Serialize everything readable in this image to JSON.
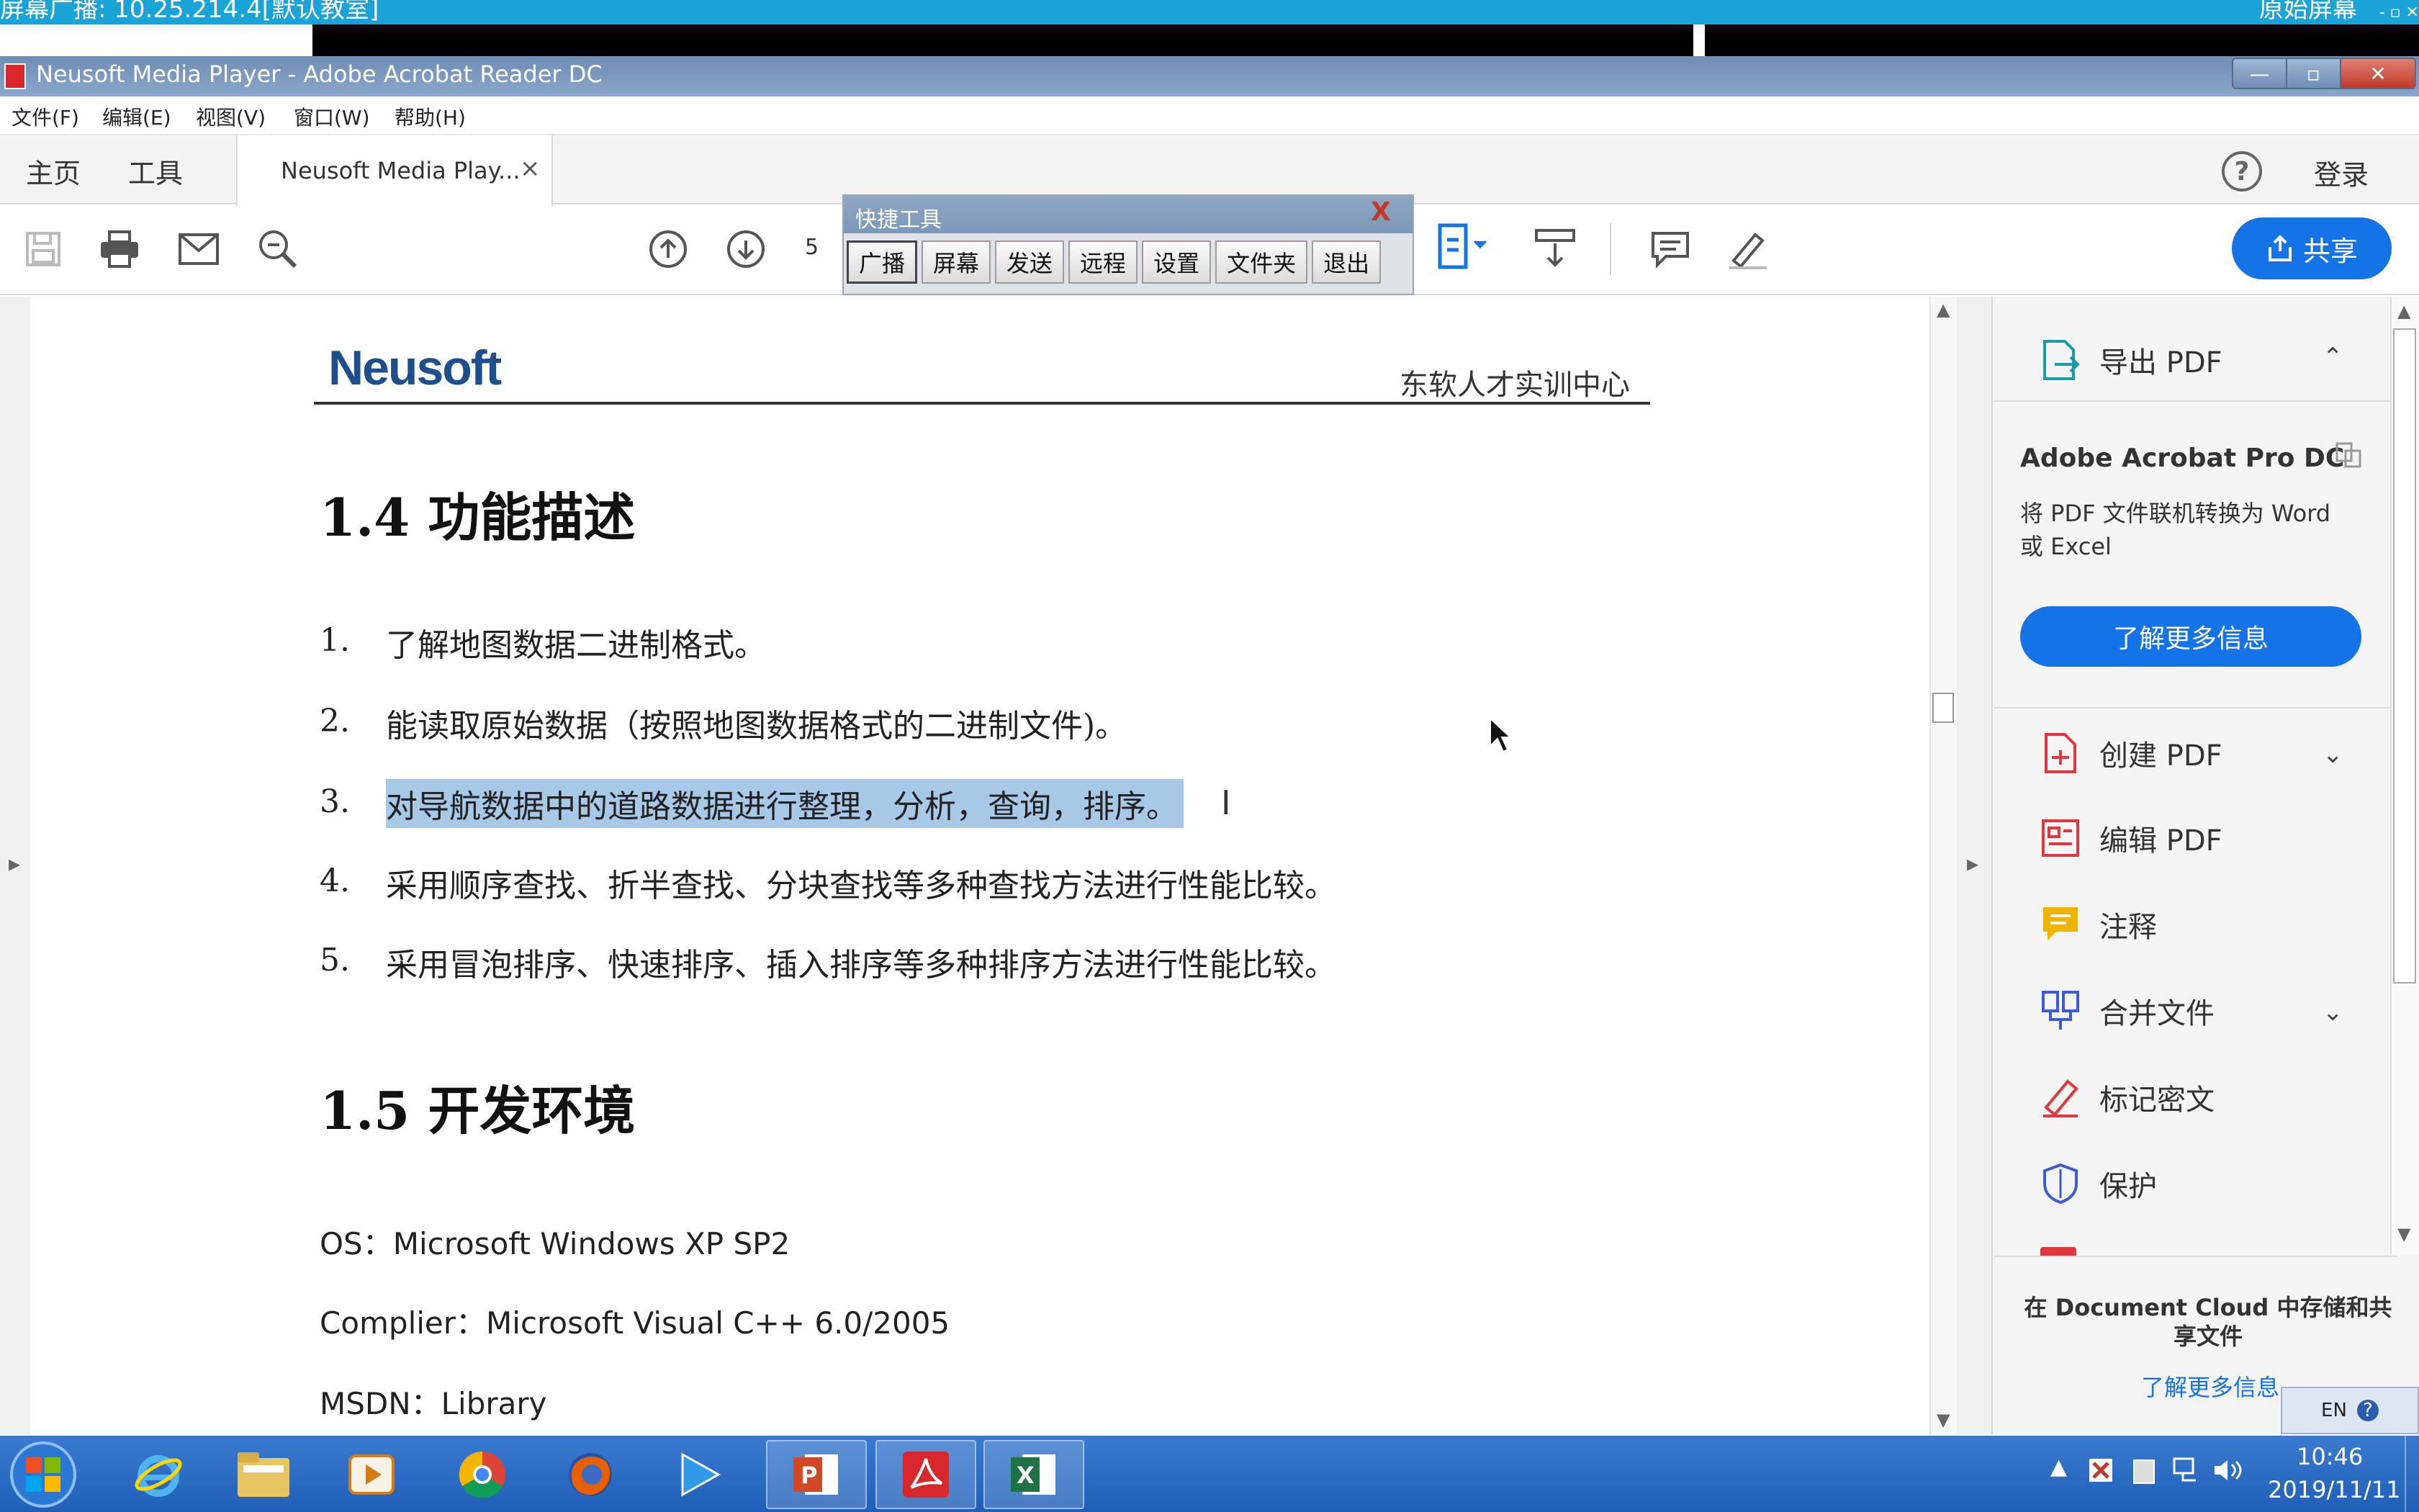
{
  "remote": {
    "title": "屏幕广播: 10.25.214.4[默认教室]",
    "right_label": "原始屏幕",
    "controls": "- ▫ ✕"
  },
  "window": {
    "title": "Neusoft Media Player - Adobe Acrobat Reader DC",
    "min": "—",
    "max": "▫",
    "close": "✕"
  },
  "menu": [
    "文件(F)",
    "编辑(E)",
    "视图(V)",
    "窗口(W)",
    "帮助(H)"
  ],
  "tabs": {
    "home": "主页",
    "tools": "工具",
    "doc": "Neusoft Media Play...",
    "doc_close": "×",
    "help": "?",
    "login": "登录"
  },
  "toolbar": {
    "page_number": "5",
    "share": "共享"
  },
  "quick_tools": {
    "title": "快捷工具",
    "close": "X",
    "buttons": [
      "广播",
      "屏幕",
      "发送",
      "远程",
      "设置",
      "文件夹",
      "退出"
    ]
  },
  "document": {
    "logo": "Neusoft",
    "header_right": "东软人才实训中心",
    "section1_title": "1.4 功能描述",
    "items": [
      {
        "num": "1.",
        "text": "了解地图数据二进制格式。"
      },
      {
        "num": "2.",
        "text": "能读取原始数据（按照地图数据格式的二进制文件)。"
      },
      {
        "num": "3.",
        "text": "对导航数据中的道路数据进行整理，分析，查询，排序。"
      },
      {
        "num": "4.",
        "text": "采用顺序查找、折半查找、分块查找等多种查找方法进行性能比较。"
      },
      {
        "num": "5.",
        "text": "采用冒泡排序、快速排序、插入排序等多种排序方法进行性能比较。"
      }
    ],
    "section2_title": "1.5 开发环境",
    "env": [
      "OS：Microsoft Windows XP SP2",
      "Complier：Microsoft Visual C++ 6.0/2005",
      "MSDN：Library"
    ]
  },
  "right_panel": {
    "export_pdf": "导出 PDF",
    "promo_title": "Adobe Acrobat Pro DC",
    "promo_body": "将 PDF 文件联机转换为 Word 或 Excel",
    "promo_button": "了解更多信息",
    "tools": [
      {
        "label": "创建 PDF",
        "icon": "create-pdf-icon",
        "color": "#e0383e"
      },
      {
        "label": "编辑 PDF",
        "icon": "edit-pdf-icon",
        "color": "#e0383e"
      },
      {
        "label": "注释",
        "icon": "comment-icon",
        "color": "#f0b400"
      },
      {
        "label": "合并文件",
        "icon": "combine-files-icon",
        "color": "#3b5bdb"
      },
      {
        "label": "标记密文",
        "icon": "redact-icon",
        "color": "#e0383e"
      },
      {
        "label": "保护",
        "icon": "protect-icon",
        "color": "#3b5bdb"
      }
    ],
    "cloud_text": "在 Document Cloud 中存储和共享文件",
    "cloud_link": "了解更多信息"
  },
  "lang_bar": {
    "lang": "EN",
    "help": "?"
  },
  "taskbar": {
    "time": "10:46",
    "date": "2019/11/11"
  },
  "colors": {
    "accent": "#1473e6",
    "remote_bar": "#1aa3d6",
    "selection": "#a8c8e8",
    "taskbar": "#2a6cc4"
  }
}
